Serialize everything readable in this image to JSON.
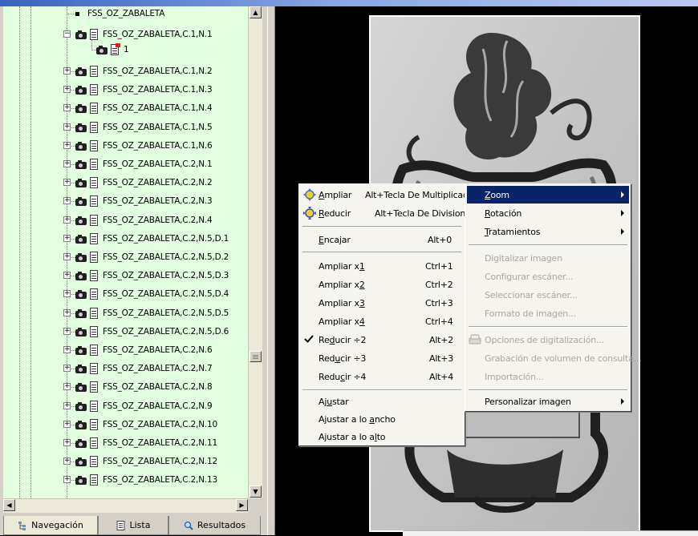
{
  "tree": {
    "root_label": "FSS_OZ_ZABALETA",
    "expanded_label": "FSS_OZ_ZABALETA,C.1,N.1",
    "child_label": "1",
    "items": [
      "FSS_OZ_ZABALETA,C.1,N.2",
      "FSS_OZ_ZABALETA,C.1,N.3",
      "FSS_OZ_ZABALETA,C.1,N.4",
      "FSS_OZ_ZABALETA,C.1,N.5",
      "FSS_OZ_ZABALETA,C.1,N.6",
      "FSS_OZ_ZABALETA,C.2,N.1",
      "FSS_OZ_ZABALETA,C.2,N.2",
      "FSS_OZ_ZABALETA,C.2,N.3",
      "FSS_OZ_ZABALETA,C.2,N.4",
      "FSS_OZ_ZABALETA,C.2,N.5,D.1",
      "FSS_OZ_ZABALETA,C.2,N.5,D.2",
      "FSS_OZ_ZABALETA,C.2,N.5,D.3",
      "FSS_OZ_ZABALETA,C.2,N.5,D.4",
      "FSS_OZ_ZABALETA,C.2,N.5,D.5",
      "FSS_OZ_ZABALETA,C.2,N.5,D.6",
      "FSS_OZ_ZABALETA,C.2,N.6",
      "FSS_OZ_ZABALETA,C.2,N.7",
      "FSS_OZ_ZABALETA,C.2,N.8",
      "FSS_OZ_ZABALETA,C.2,N.9",
      "FSS_OZ_ZABALETA,C.2,N.10",
      "FSS_OZ_ZABALETA,C.2,N.11",
      "FSS_OZ_ZABALETA,C.2,N.12",
      "FSS_OZ_ZABALETA,C.2,N.13"
    ]
  },
  "tabs": [
    {
      "label": "Navegación",
      "icon": "tree-icon"
    },
    {
      "label": "Lista",
      "icon": "list-icon"
    },
    {
      "label": "Resultados",
      "icon": "results-icon"
    }
  ],
  "zoom_menu": {
    "ampliar": {
      "pre": "",
      "u": "A",
      "post": "mpliar",
      "shortcut": "Alt+Tecla De Multiplicacion",
      "icon": "zoom-in-icon"
    },
    "reducir": {
      "pre": "",
      "u": "R",
      "post": "educir",
      "shortcut": "Alt+Tecla De Division",
      "icon": "zoom-out-icon"
    },
    "encajar": {
      "pre": "",
      "u": "E",
      "post": "ncajar",
      "shortcut": "Alt+0"
    },
    "x1": {
      "pre": "Ampliar x",
      "u": "1",
      "post": "",
      "shortcut": "Ctrl+1"
    },
    "x2": {
      "pre": "Ampliar x",
      "u": "2",
      "post": "",
      "shortcut": "Ctrl+2"
    },
    "x3": {
      "pre": "Ampliar x",
      "u": "3",
      "post": "",
      "shortcut": "Ctrl+3"
    },
    "x4": {
      "pre": "Ampliar x",
      "u": "4",
      "post": "",
      "shortcut": "Ctrl+4"
    },
    "r2": {
      "pre": "Re",
      "u": "d",
      "post": "ucir ÷2",
      "shortcut": "Alt+2",
      "checked": true
    },
    "r3": {
      "pre": "Red",
      "u": "u",
      "post": "cir ÷3",
      "shortcut": "Alt+3"
    },
    "r4": {
      "pre": "Redu",
      "u": "c",
      "post": "ir ÷4",
      "shortcut": "Alt+4"
    },
    "ajustar": {
      "pre": "Aj",
      "u": "u",
      "post": "star"
    },
    "ancho": {
      "pre": "Ajustar a lo ",
      "u": "a",
      "post": "ncho"
    },
    "alto": {
      "pre": "Ajustar a lo a",
      "u": "l",
      "post": "to"
    }
  },
  "main_menu": {
    "zoom": {
      "pre": "",
      "u": "Z",
      "post": "oom"
    },
    "rotacion": {
      "pre": "",
      "u": "R",
      "post": "otación"
    },
    "tratamientos": {
      "pre": "",
      "u": "T",
      "post": "ratamientos"
    },
    "digitalizar": "Digitalizar imagen",
    "configurar": "Configurar escáner...",
    "seleccionar": "Seleccionar escáner...",
    "formato": "Formato de imagen...",
    "opciones": "Opciones de digitalización...",
    "grabacion": "Grabación de volumen de consulta...",
    "importacion": "Importación...",
    "personalizar": "Personalizar imagen"
  }
}
